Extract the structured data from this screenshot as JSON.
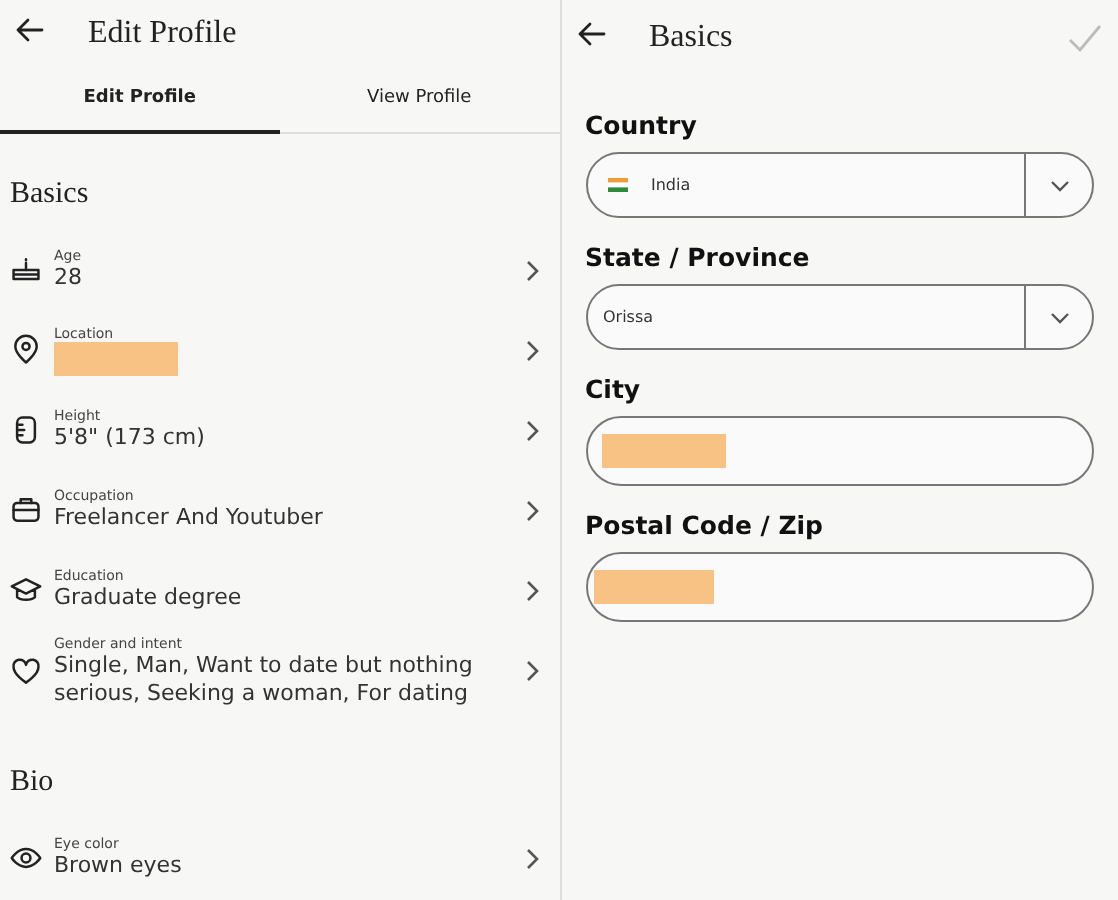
{
  "edit_screen": {
    "title": "Edit Profile",
    "tabs": [
      {
        "label": "Edit Profile",
        "selected": true
      },
      {
        "label": "View Profile",
        "selected": false
      }
    ],
    "sections": [
      {
        "heading": "Basics",
        "items": [
          {
            "label": "Age",
            "value": "28"
          },
          {
            "label": "Location"
          },
          {
            "label": "Height",
            "value": "5'8\" (173 cm)"
          },
          {
            "label": "Occupation",
            "value": "Freelancer And Youtuber"
          },
          {
            "label": "Education",
            "value": "Graduate degree"
          },
          {
            "label": "Gender and intent",
            "value": "Single, Man, Want to date but nothing serious, Seeking a woman, For dating"
          }
        ]
      },
      {
        "heading": "Bio",
        "items": [
          {
            "label": "Eye color",
            "value": "Brown eyes"
          }
        ]
      }
    ]
  },
  "basics_screen": {
    "title": "Basics",
    "save_enabled": false,
    "fields": [
      {
        "kind": "select",
        "label": "Country",
        "value": "India"
      },
      {
        "kind": "select",
        "label": "State / Province",
        "value": "Orissa"
      },
      {
        "kind": "text",
        "label": "City"
      },
      {
        "kind": "text",
        "label": "Postal Code / Zip"
      }
    ]
  }
}
